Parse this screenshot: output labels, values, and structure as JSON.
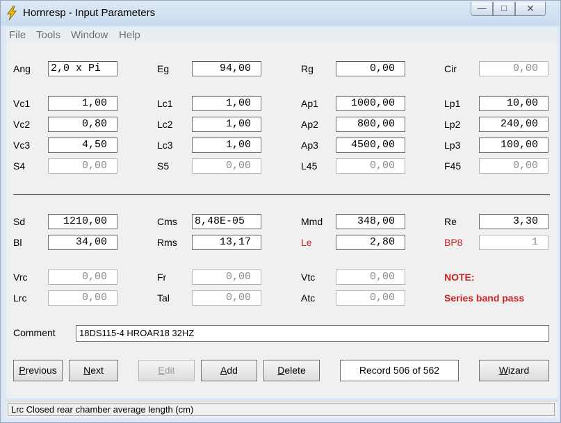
{
  "window": {
    "title": "Hornresp - Input Parameters"
  },
  "window_controls": {
    "minimize": "—",
    "maximize": "□",
    "close": "✕"
  },
  "menu": [
    "File",
    "Tools",
    "Window",
    "Help"
  ],
  "params": {
    "ang": {
      "label": "Ang",
      "value": "2,0 x Pi"
    },
    "eg": {
      "label": "Eg",
      "value": "94,00"
    },
    "rg": {
      "label": "Rg",
      "value": "0,00"
    },
    "cir": {
      "label": "Cir",
      "value": "0,00"
    },
    "vc1": {
      "label": "Vc1",
      "value": "1,00"
    },
    "lc1": {
      "label": "Lc1",
      "value": "1,00"
    },
    "ap1": {
      "label": "Ap1",
      "value": "1000,00"
    },
    "lp1": {
      "label": "Lp1",
      "value": "10,00"
    },
    "vc2": {
      "label": "Vc2",
      "value": "0,80"
    },
    "lc2": {
      "label": "Lc2",
      "value": "1,00"
    },
    "ap2": {
      "label": "Ap2",
      "value": "800,00"
    },
    "lp2": {
      "label": "Lp2",
      "value": "240,00"
    },
    "vc3": {
      "label": "Vc3",
      "value": "4,50"
    },
    "lc3": {
      "label": "Lc3",
      "value": "1,00"
    },
    "ap3": {
      "label": "Ap3",
      "value": "4500,00"
    },
    "lp3": {
      "label": "Lp3",
      "value": "100,00"
    },
    "s4": {
      "label": "S4",
      "value": "0,00"
    },
    "s5": {
      "label": "S5",
      "value": "0,00"
    },
    "l45": {
      "label": "L45",
      "value": "0,00"
    },
    "f45": {
      "label": "F45",
      "value": "0,00"
    },
    "sd": {
      "label": "Sd",
      "value": "1210,00"
    },
    "cms": {
      "label": "Cms",
      "value": "8,48E-05"
    },
    "mmd": {
      "label": "Mmd",
      "value": "348,00"
    },
    "re": {
      "label": "Re",
      "value": "3,30"
    },
    "bl": {
      "label": "Bl",
      "value": "34,00"
    },
    "rms": {
      "label": "Rms",
      "value": "13,17"
    },
    "le": {
      "label": "Le",
      "value": "2,80"
    },
    "bp8": {
      "label": "BP8",
      "value": "1"
    },
    "vrc": {
      "label": "Vrc",
      "value": "0,00"
    },
    "fr": {
      "label": "Fr",
      "value": "0,00"
    },
    "vtc": {
      "label": "Vtc",
      "value": "0,00"
    },
    "lrc": {
      "label": "Lrc",
      "value": "0,00"
    },
    "tal": {
      "label": "Tal",
      "value": "0,00"
    },
    "atc": {
      "label": "Atc",
      "value": "0,00"
    }
  },
  "note": {
    "title": "NOTE:",
    "text": "Series band pass"
  },
  "comment": {
    "label": "Comment",
    "value": "18DS115-4 HROAR18 32HZ"
  },
  "buttons": {
    "previous": {
      "first": "P",
      "rest": "revious"
    },
    "next": {
      "first": "N",
      "rest": "ext"
    },
    "edit": {
      "first": "E",
      "rest": "dit"
    },
    "add": {
      "first": "A",
      "rest": "dd"
    },
    "delete": {
      "first": "D",
      "rest": "elete"
    },
    "wizard": {
      "first": "W",
      "rest": "izard"
    }
  },
  "record": "Record 506 of 562",
  "status": "Lrc  Closed rear chamber average length  (cm)",
  "colors": {
    "accent_red": "#cc2222",
    "lightning": "#f2c200"
  }
}
